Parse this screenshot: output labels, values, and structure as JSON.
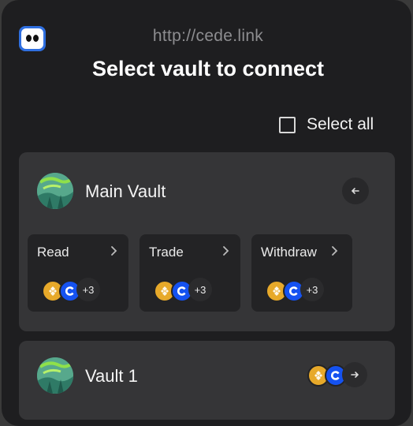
{
  "header": {
    "url": "http://cede.link",
    "title": "Select vault to connect"
  },
  "select_all": {
    "label": "Select all",
    "checked": false
  },
  "vaults": [
    {
      "name": "Main Vault",
      "expanded": true,
      "permissions": [
        {
          "label": "Read",
          "tokens": [
            "binance-icon",
            "coinbase-icon"
          ],
          "more": "+3"
        },
        {
          "label": "Trade",
          "tokens": [
            "binance-icon",
            "coinbase-icon"
          ],
          "more": "+3"
        },
        {
          "label": "Withdraw",
          "tokens": [
            "binance-icon",
            "coinbase-icon"
          ],
          "more": "+3"
        }
      ]
    },
    {
      "name": "Vault 1",
      "expanded": false,
      "tokens": [
        "binance-icon",
        "coinbase-icon"
      ]
    }
  ],
  "colors": {
    "background": "#1e1e20",
    "card": "#353537",
    "permission_card": "#232325",
    "binance": "#e7a92a",
    "coinbase": "#1552f0"
  }
}
